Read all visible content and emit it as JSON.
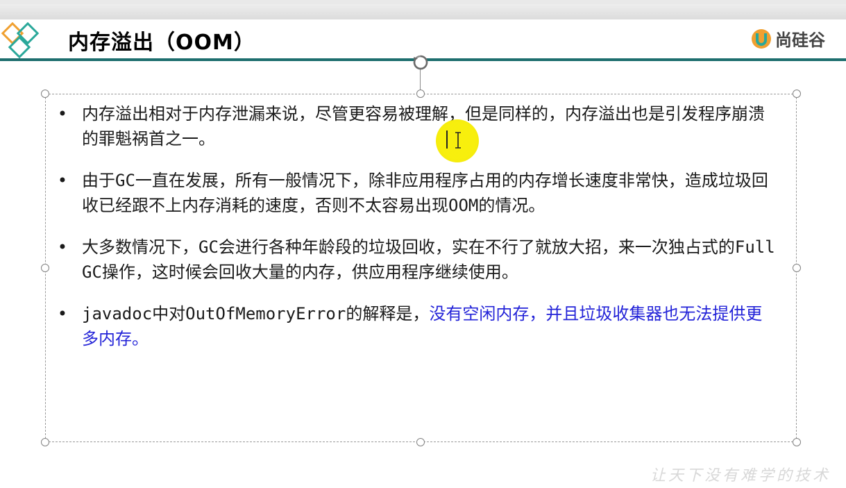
{
  "slide": {
    "title": "内存溢出（OOM）",
    "brand": "尚硅谷",
    "watermark": "让天下没有难学的技术"
  },
  "bullets": [
    {
      "dot": "•",
      "text": "内存溢出相对于内存泄漏来说，尽管更容易被理解，但是同样的，内存溢出也是引发程序崩溃的罪魁祸首之一。",
      "highlight": ""
    },
    {
      "dot": "•",
      "text": "由于GC一直在发展，所有一般情况下，除非应用程序占用的内存增长速度非常快，造成垃圾回收已经跟不上内存消耗的速度，否则不太容易出现OOM的情况。",
      "highlight": ""
    },
    {
      "dot": "•",
      "text": "大多数情况下，GC会进行各种年龄段的垃圾回收，实在不行了就放大招，来一次独占式的Full GC操作，这时候会回收大量的内存，供应用程序继续使用。",
      "highlight": ""
    },
    {
      "dot": "•",
      "text": "javadoc中对OutOfMemoryError的解释是，",
      "highlight": "没有空闲内存，并且垃圾收集器也无法提供更多内存。"
    }
  ],
  "colors": {
    "header_rule": "#1d6e6e",
    "highlight_text": "#2323d8",
    "logo_orange": "#f0a030",
    "logo_teal": "#2aa89a",
    "cursor_highlight": "#f7ee00"
  },
  "icons": {
    "logo": "diamond-logo-icon",
    "brand": "brand-u-logo-icon",
    "rotate": "rotate-handle-icon",
    "cursor": "text-cursor-icon"
  }
}
